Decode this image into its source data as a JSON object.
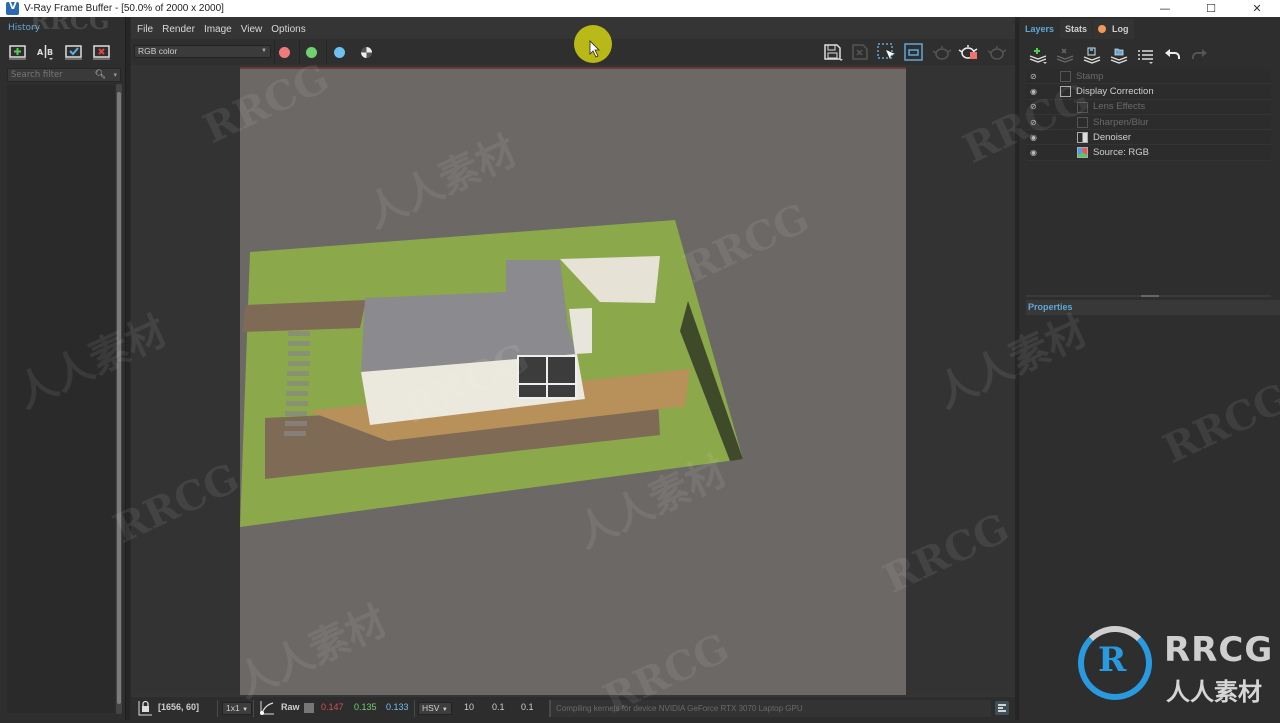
{
  "window": {
    "title": "V-Ray Frame Buffer - [50.0% of 2000 x 2000]",
    "controls": [
      "minimize",
      "maximize",
      "close"
    ]
  },
  "history_panel": {
    "tab_label": "History",
    "tools": [
      "save-to-history",
      "ab-compare",
      "load-history",
      "delete-history"
    ],
    "search_placeholder": "Search filter"
  },
  "menubar": {
    "items": [
      "File",
      "Render",
      "Image",
      "View",
      "Options"
    ]
  },
  "toolbar": {
    "channel_selected": "RGB color",
    "channel_buttons": [
      {
        "name": "red-channel",
        "color": "#f07b7b"
      },
      {
        "name": "green-channel",
        "color": "#6fd16f"
      },
      {
        "name": "blue-channel",
        "color": "#6ec1f0"
      },
      {
        "name": "alpha-channel",
        "color": "#dddddd"
      }
    ],
    "right_tools": [
      "save-image",
      "clear-image",
      "region-render",
      "track-mouse",
      "render-last",
      "render-interactive",
      "render"
    ]
  },
  "viewport": {
    "render_scene": "3D render of modern house with flat roof on grass lot",
    "colors": {
      "background": "#6b6865",
      "grass": "#8ba84a",
      "roof": "#8b8a8e",
      "wall": "#e9e6dc",
      "gravel": "#7f6a55",
      "stone": "#b8905a"
    }
  },
  "statusbar": {
    "coordinates": "[1656, 60]",
    "sample_size": "1x1",
    "color_mode": "Raw",
    "r_value": "0.147",
    "g_value": "0.135",
    "b_value": "0.133",
    "color_space": "HSV",
    "h_value": "10",
    "s_value": "0.1",
    "v_value": "0.1",
    "message": "Compiling kernels for device NVIDIA GeForce RTX 3070 Laptop GPU"
  },
  "right_panel": {
    "tabs": [
      {
        "label": "Layers",
        "active": true
      },
      {
        "label": "Stats",
        "active": false
      },
      {
        "label": "Log",
        "active": false,
        "indicator_color": "#f09a5a"
      }
    ],
    "layer_tools": [
      "create-layer",
      "delete-layer",
      "save-layer-tree",
      "load-layer-tree",
      "layer-presets",
      "undo",
      "redo"
    ],
    "layers": [
      {
        "name": "Stamp",
        "visible": false,
        "enabled": false,
        "indent": 0
      },
      {
        "name": "Display Correction",
        "visible": true,
        "enabled": true,
        "indent": 0
      },
      {
        "name": "Lens Effects",
        "visible": false,
        "enabled": false,
        "indent": 1
      },
      {
        "name": "Sharpen/Blur",
        "visible": false,
        "enabled": false,
        "indent": 1
      },
      {
        "name": "Denoiser",
        "visible": true,
        "enabled": true,
        "indent": 1
      },
      {
        "name": "Source: RGB",
        "visible": true,
        "enabled": true,
        "indent": 1
      }
    ],
    "properties_label": "Properties"
  },
  "watermarks": {
    "text_latin": "RRCG",
    "text_cjk": "人人素材"
  },
  "accent_color": "#5fa7d6"
}
